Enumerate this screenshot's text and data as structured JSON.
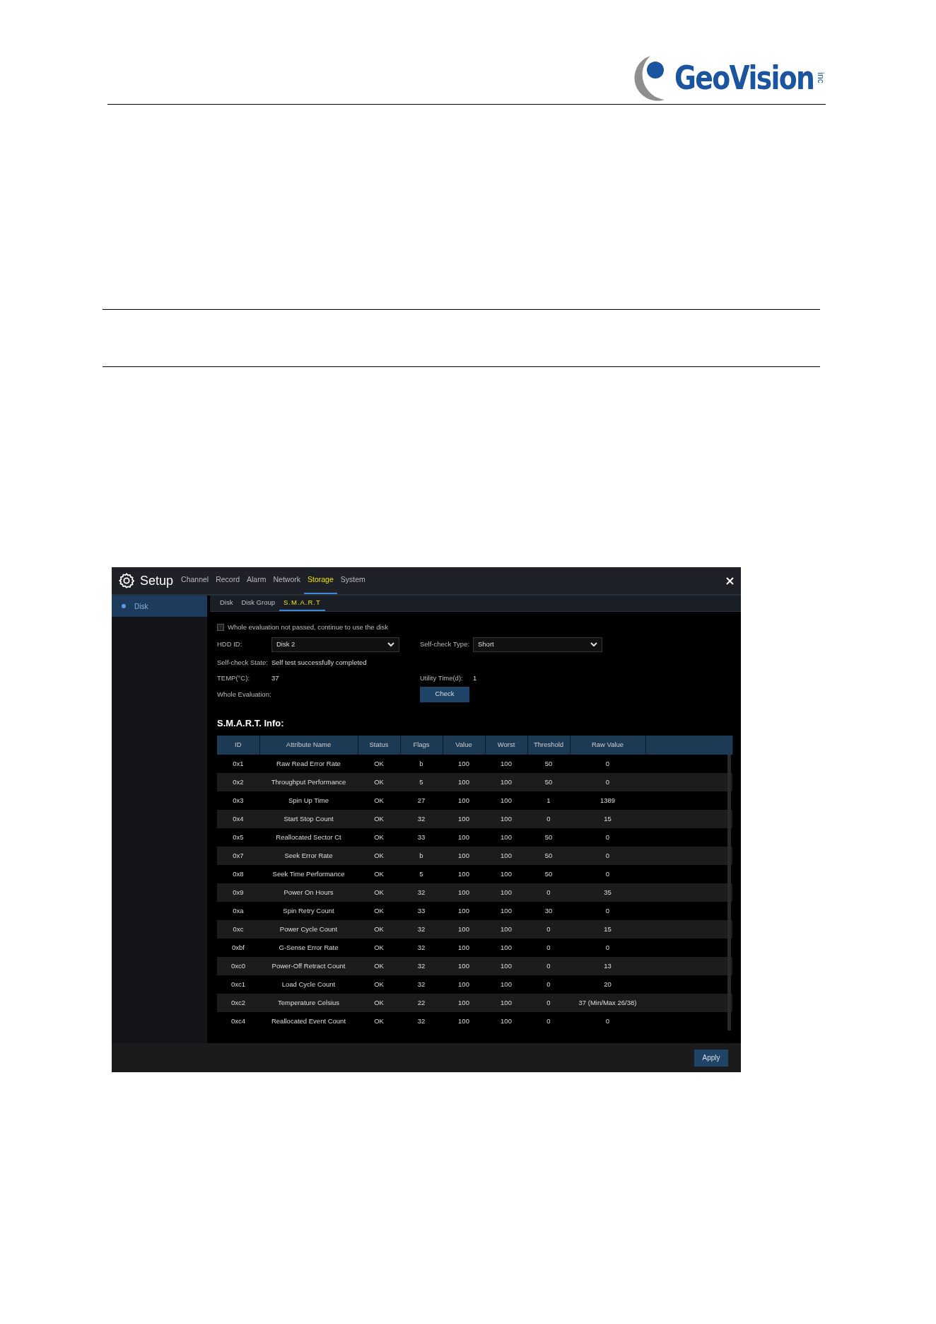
{
  "logo": {
    "name": "GeoVision",
    "suffix": "inc"
  },
  "app": {
    "title": "Setup",
    "menu": [
      {
        "label": "Channel",
        "selected": false
      },
      {
        "label": "Record",
        "selected": false
      },
      {
        "label": "Alarm",
        "selected": false
      },
      {
        "label": "Network",
        "selected": false
      },
      {
        "label": "Storage",
        "selected": true
      },
      {
        "label": "System",
        "selected": false
      }
    ],
    "sidebar": {
      "items": [
        {
          "label": "Disk",
          "selected": true
        }
      ]
    },
    "subtabs": [
      {
        "label": "Disk",
        "selected": false
      },
      {
        "label": "Disk Group",
        "selected": false
      },
      {
        "label": "S.M.A.R.T",
        "selected": true
      }
    ],
    "continue_checkbox": {
      "label": "Whole evaluation not passed, continue to use the disk",
      "checked": false
    },
    "hdd_id": {
      "label": "HDD ID:",
      "value": "Disk 2"
    },
    "self_check_type": {
      "label": "Self-check Type:",
      "value": "Short"
    },
    "self_check_state": {
      "label": "Self-check State:",
      "value": "Self test successfully completed"
    },
    "temp": {
      "label": "TEMP(°C):",
      "value": "37"
    },
    "utility_time": {
      "label": "Utility Time(d):",
      "value": "1"
    },
    "whole_evaluation": {
      "label": "Whole Evaluation:"
    },
    "check_button": "Check",
    "smart_title": "S.M.A.R.T. Info:",
    "table": {
      "columns": [
        "ID",
        "Attribute Name",
        "Status",
        "Flags",
        "Value",
        "Worst",
        "Threshold",
        "Raw Value"
      ],
      "rows": [
        [
          "0x1",
          "Raw Read Error Rate",
          "OK",
          "b",
          "100",
          "100",
          "50",
          "0"
        ],
        [
          "0x2",
          "Throughput Performance",
          "OK",
          "5",
          "100",
          "100",
          "50",
          "0"
        ],
        [
          "0x3",
          "Spin Up Time",
          "OK",
          "27",
          "100",
          "100",
          "1",
          "1389"
        ],
        [
          "0x4",
          "Start Stop Count",
          "OK",
          "32",
          "100",
          "100",
          "0",
          "15"
        ],
        [
          "0x5",
          "Reallocated Sector Ct",
          "OK",
          "33",
          "100",
          "100",
          "50",
          "0"
        ],
        [
          "0x7",
          "Seek Error Rate",
          "OK",
          "b",
          "100",
          "100",
          "50",
          "0"
        ],
        [
          "0x8",
          "Seek Time Performance",
          "OK",
          "5",
          "100",
          "100",
          "50",
          "0"
        ],
        [
          "0x9",
          "Power On Hours",
          "OK",
          "32",
          "100",
          "100",
          "0",
          "35"
        ],
        [
          "0xa",
          "Spin Retry Count",
          "OK",
          "33",
          "100",
          "100",
          "30",
          "0"
        ],
        [
          "0xc",
          "Power Cycle Count",
          "OK",
          "32",
          "100",
          "100",
          "0",
          "15"
        ],
        [
          "0xbf",
          "G-Sense Error Rate",
          "OK",
          "32",
          "100",
          "100",
          "0",
          "0"
        ],
        [
          "0xc0",
          "Power-Off Retract Count",
          "OK",
          "32",
          "100",
          "100",
          "0",
          "13"
        ],
        [
          "0xc1",
          "Load Cycle Count",
          "OK",
          "32",
          "100",
          "100",
          "0",
          "20"
        ],
        [
          "0xc2",
          "Temperature Celsius",
          "OK",
          "22",
          "100",
          "100",
          "0",
          "37 (Min/Max 26/38)"
        ],
        [
          "0xc4",
          "Reallocated Event Count",
          "OK",
          "32",
          "100",
          "100",
          "0",
          "0"
        ]
      ]
    },
    "apply_button": "Apply"
  }
}
